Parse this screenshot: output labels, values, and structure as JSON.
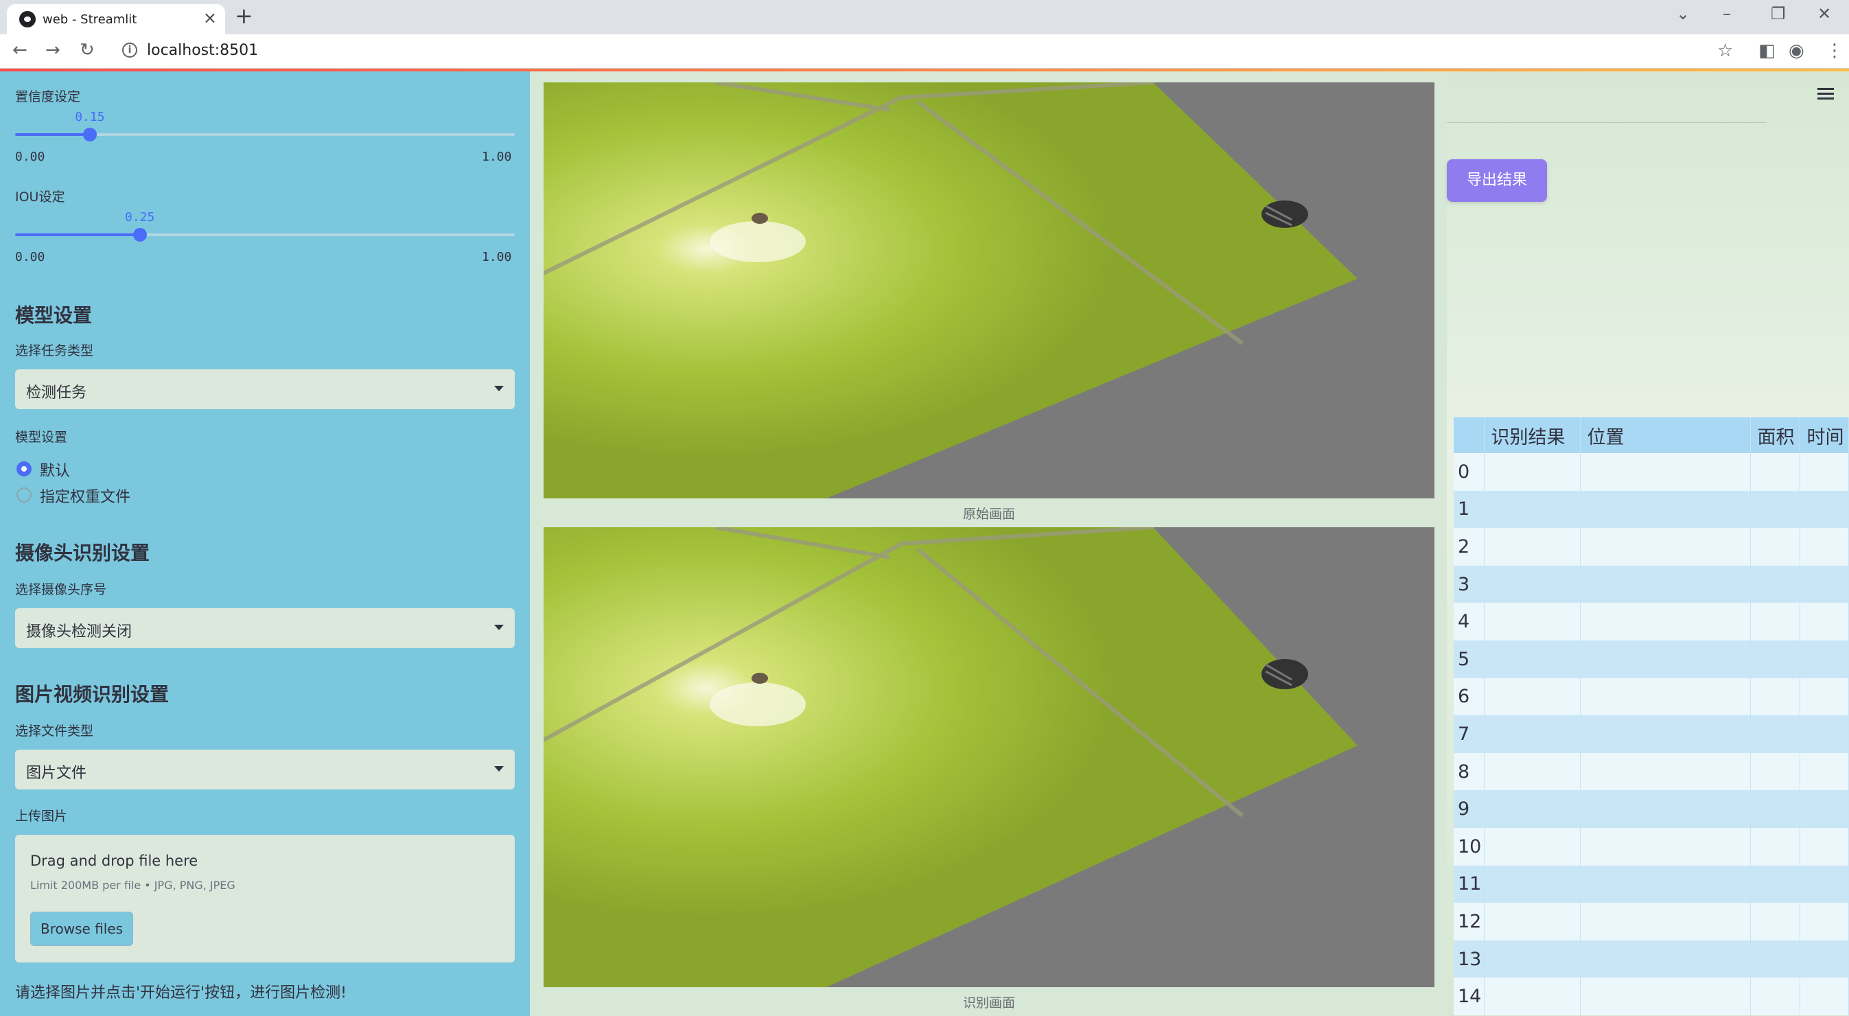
{
  "browser": {
    "tab_title": "web - Streamlit",
    "url": "localhost:8501"
  },
  "sidebar": {
    "confidence": {
      "label": "置信度设定",
      "value": "0.15",
      "min": "0.00",
      "max": "1.00",
      "fraction": 0.15
    },
    "iou": {
      "label": "IOU设定",
      "value": "0.25",
      "min": "0.00",
      "max": "1.00",
      "fraction": 0.25
    },
    "model_heading": "模型设置",
    "task_label": "选择任务类型",
    "task_value": "检测任务",
    "model_label": "模型设置",
    "model_options": [
      {
        "label": "默认",
        "selected": true
      },
      {
        "label": "指定权重文件",
        "selected": false
      }
    ],
    "camera_heading": "摄像头识别设置",
    "camera_label": "选择摄像头序号",
    "camera_value": "摄像头检测关闭",
    "media_heading": "图片视频识别设置",
    "file_type_label": "选择文件类型",
    "file_type_value": "图片文件",
    "upload_label": "上传图片",
    "upload_title": "Drag and drop file here",
    "upload_limit": "Limit 200MB per file • JPG, PNG, JPEG",
    "browse_label": "Browse files",
    "footer_text": "请选择图片并点击'开始运行'按钮，进行图片检测!"
  },
  "main": {
    "original_caption": "原始画面",
    "result_caption": "识别画面",
    "export_label": "导出结果",
    "table": {
      "columns": [
        "",
        "识别结果",
        "位置",
        "面积",
        "时间"
      ],
      "rows": [
        "0",
        "1",
        "2",
        "3",
        "4",
        "5",
        "6",
        "7",
        "8",
        "9",
        "10",
        "11",
        "12",
        "13",
        "14"
      ]
    }
  },
  "colors": {
    "sidebar": "#7bc7de",
    "accent": "#4a6cf7",
    "export_button": "#8f7df0",
    "tile": "#a8c63a"
  }
}
